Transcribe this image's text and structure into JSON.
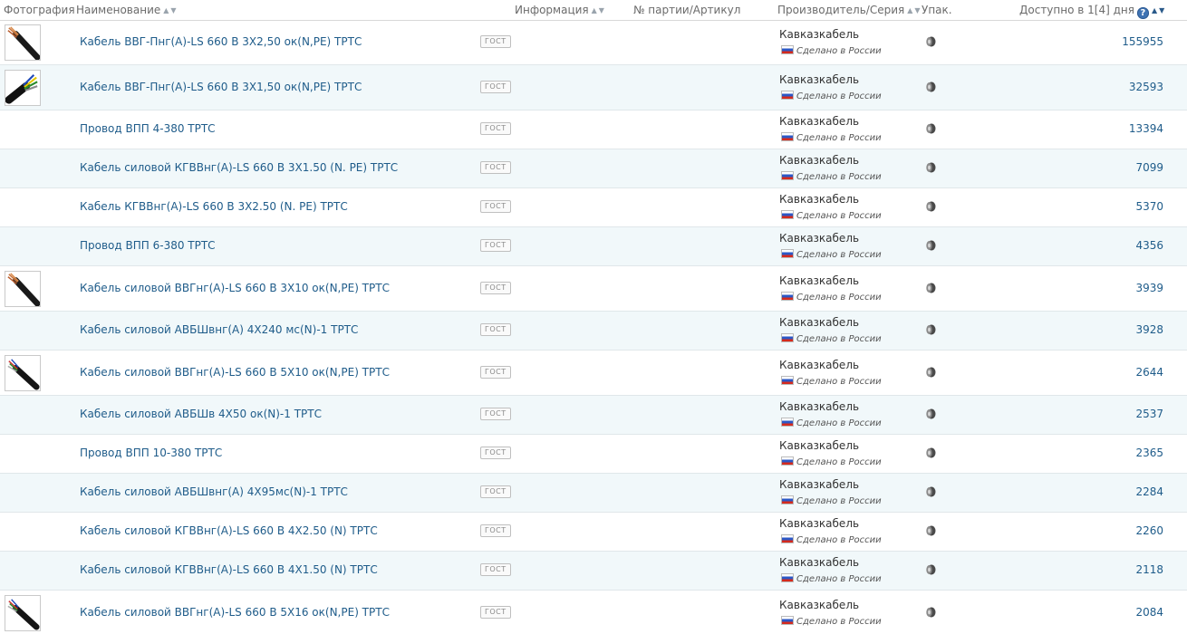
{
  "header": {
    "photo": "Фотография",
    "name": "Наименование",
    "info": "Информация",
    "batch": "№ партии/Артикул",
    "maker": "Производитель/Серия",
    "pack": "Упак.",
    "avail": "Доступно в 1[4] дня",
    "help_icon": "?"
  },
  "icons": {
    "sort": "sort-arrows-icon",
    "help": "question-circle-icon",
    "pack": "package-roll-icon",
    "flag": "russia-flag-icon",
    "thumb": "cable-thumbnail"
  },
  "colors": {
    "link": "#1f5c8a",
    "row_alt": "#f1f8fa",
    "help": "#3f73b3"
  },
  "rows": [
    {
      "name": "Кабель ВВГ-Пнг(А)-LS 660 В 3Х2,50 ок(N,PE) ТРТС",
      "badge": "ГОСТ",
      "maker": "Кавказкабель",
      "made": "Сделано в России",
      "avail": "155955"
    },
    {
      "name": "Кабель ВВГ-Пнг(А)-LS 660 В 3Х1,50 ок(N,PE) ТРТС",
      "badge": "ГОСТ",
      "maker": "Кавказкабель",
      "made": "Сделано в России",
      "avail": "32593"
    },
    {
      "name": "Провод ВПП 4-380 ТРТС",
      "badge": "ГОСТ",
      "maker": "Кавказкабель",
      "made": "Сделано в России",
      "avail": "13394"
    },
    {
      "name": "Кабель силовой КГВВнг(А)-LS 660 В 3Х1.50 (N. PE) ТРТС",
      "badge": "ГОСТ",
      "maker": "Кавказкабель",
      "made": "Сделано в России",
      "avail": "7099"
    },
    {
      "name": "Кабель КГВВнг(А)-LS 660 В 3Х2.50 (N. PE) ТРТС",
      "badge": "ГОСТ",
      "maker": "Кавказкабель",
      "made": "Сделано в России",
      "avail": "5370"
    },
    {
      "name": "Провод ВПП 6-380 ТРТС",
      "badge": "ГОСТ",
      "maker": "Кавказкабель",
      "made": "Сделано в России",
      "avail": "4356"
    },
    {
      "name": "Кабель силовой ВВГнг(А)-LS 660 В 3Х10 ок(N,PE) ТРТС",
      "badge": "ГОСТ",
      "maker": "Кавказкабель",
      "made": "Сделано в России",
      "avail": "3939"
    },
    {
      "name": "Кабель силовой АВБШвнг(А) 4Х240 мс(N)-1 ТРТС",
      "badge": "ГОСТ",
      "maker": "Кавказкабель",
      "made": "Сделано в России",
      "avail": "3928"
    },
    {
      "name": "Кабель силовой ВВГнг(А)-LS 660 В 5Х10 ок(N,PE) ТРТС",
      "badge": "ГОСТ",
      "maker": "Кавказкабель",
      "made": "Сделано в России",
      "avail": "2644"
    },
    {
      "name": "Кабель силовой АВБШв 4Х50 ок(N)-1 ТРТС",
      "badge": "ГОСТ",
      "maker": "Кавказкабель",
      "made": "Сделано в России",
      "avail": "2537"
    },
    {
      "name": "Провод ВПП 10-380 ТРТС",
      "badge": "ГОСТ",
      "maker": "Кавказкабель",
      "made": "Сделано в России",
      "avail": "2365"
    },
    {
      "name": "Кабель силовой АВБШвнг(А) 4Х95мс(N)-1 ТРТС",
      "badge": "ГОСТ",
      "maker": "Кавказкабель",
      "made": "Сделано в России",
      "avail": "2284"
    },
    {
      "name": "Кабель силовой КГВВнг(А)-LS 660 В 4Х2.50 (N) ТРТС",
      "badge": "ГОСТ",
      "maker": "Кавказкабель",
      "made": "Сделано в России",
      "avail": "2260"
    },
    {
      "name": "Кабель силовой КГВВнг(А)-LS 660 В 4Х1.50 (N) ТРТС",
      "badge": "ГОСТ",
      "maker": "Кавказкабель",
      "made": "Сделано в России",
      "avail": "2118"
    },
    {
      "name": "Кабель силовой ВВГнг(А)-LS 660 В 5Х16 ок(N,PE) ТРТС",
      "badge": "ГОСТ",
      "maker": "Кавказкабель",
      "made": "Сделано в России",
      "avail": "2084"
    }
  ]
}
